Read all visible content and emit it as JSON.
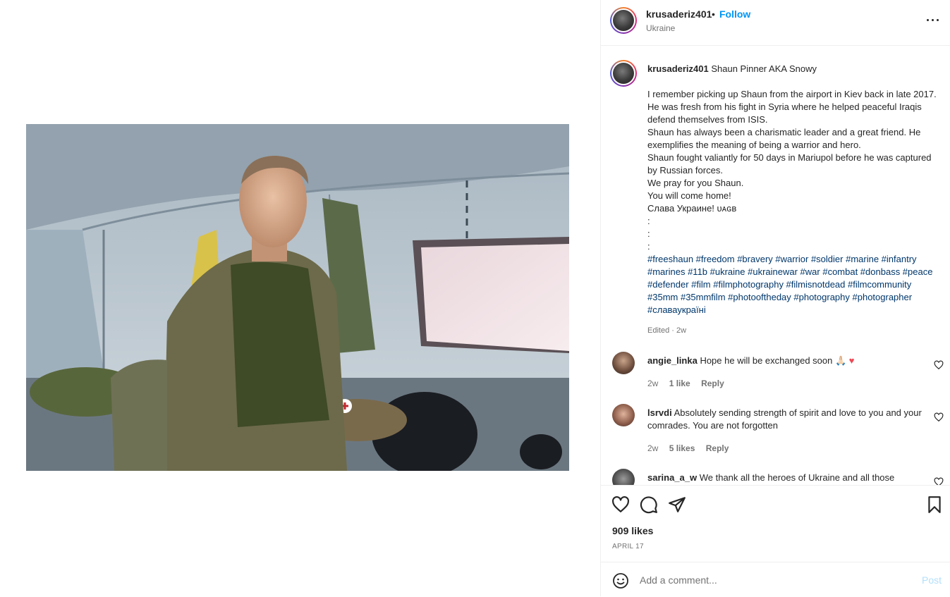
{
  "header": {
    "username": "krusaderiz401",
    "separator": "•",
    "follow_label": "Follow",
    "location": "Ukraine",
    "more_icon": "more-horizontal-icon"
  },
  "caption": {
    "username": "krusaderiz401",
    "first_line": "Shaun Pinner AKA Snowy",
    "body_lines": [
      "I remember picking up Shaun from the airport in Kiev back in late 2017. He was fresh from his fight in Syria where he helped peaceful Iraqis defend themselves from ISIS.",
      "Shaun has always been a charismatic leader and a great friend. He exemplifies the meaning of being a warrior and hero.",
      "Shaun fought valiantly for 50 days in Mariupol before he was captured by Russian forces.",
      "We pray for you Shaun.",
      "You will come home!",
      "Слава Украине! ᴜᴀɢʙ",
      ":",
      ":",
      ":"
    ],
    "hashtags": "#freeshaun #freedom #bravery #warrior #soldier #marine #infantry #marines #11b #ukraine #ukrainewar #war #combat #donbass #peace #defender #film #filmphotography #filmisnotdead #filmcommunity #35mm #35mmfilm #photooftheday #photography #photographer #славаукраїні",
    "edited": "Edited · 2w"
  },
  "comments": [
    {
      "username": "angie_linka",
      "text": "Hope he will be exchanged soon 🙏🏻",
      "emoji_tail": "♥",
      "age": "2w",
      "likes": "1 like",
      "reply": "Reply"
    },
    {
      "username": "lsrvdi",
      "text": "Absolutely sending strength of spirit and love to you and your comrades. You are not forgotten",
      "age": "2w",
      "likes": "5 likes",
      "reply": "Reply"
    },
    {
      "username": "sarina_a_w",
      "text": "We thank all the heroes of Ukraine and all those"
    }
  ],
  "actions": {
    "like_icon": "heart-icon",
    "comment_icon": "comment-icon",
    "share_icon": "share-icon",
    "save_icon": "bookmark-icon",
    "likes_count": "909 likes",
    "date": "APRIL 17"
  },
  "add_comment": {
    "placeholder": "Add a comment...",
    "post_label": "Post",
    "emoji_icon": "emoji-icon"
  },
  "colors": {
    "link_blue": "#0095f6",
    "hashtag_blue": "#00376b",
    "post_disabled": "#b2dffc",
    "muted": "#737373"
  }
}
